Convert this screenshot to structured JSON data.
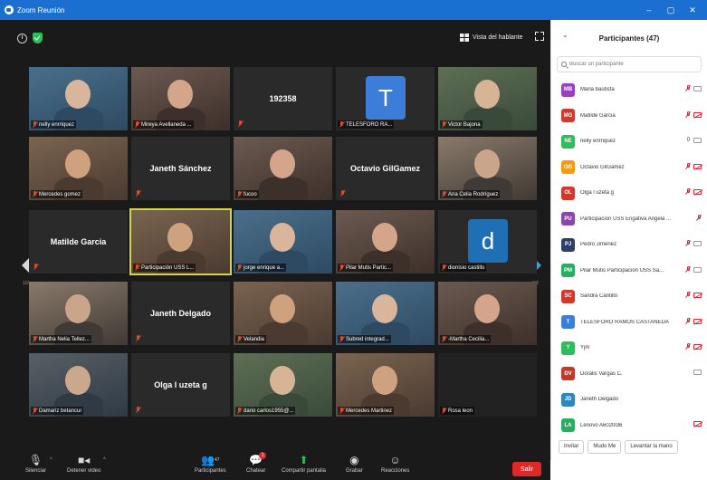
{
  "window": {
    "title": "Zoom Reunión"
  },
  "topbar": {
    "view_label": "Vista del hablante"
  },
  "colors": {
    "accent": "#1b6fd1",
    "muted": "#e24a2b",
    "leave": "#e02828",
    "active_border": "#d6d34c"
  },
  "tiles": [
    {
      "name": "nelly enrriquez",
      "type": "video"
    },
    {
      "name": "Mireya Avellaneda ...",
      "type": "video"
    },
    {
      "name": "192358",
      "type": "name"
    },
    {
      "name": "TELESFORO RA...",
      "type": "avatar",
      "letter": "T"
    },
    {
      "name": "Victor Bajona",
      "type": "video"
    },
    {
      "name": "Mercedes gomez",
      "type": "video"
    },
    {
      "name": "Janeth Sánchez",
      "type": "name"
    },
    {
      "name": "fucoo",
      "type": "video"
    },
    {
      "name": "Octavio GilGamez",
      "type": "name"
    },
    {
      "name": "Ana Celia Rodríguez",
      "type": "video"
    },
    {
      "name": "Matilde Garcia",
      "type": "name"
    },
    {
      "name": "Participación USS L...",
      "type": "video",
      "active": true
    },
    {
      "name": "jorge enrique a...",
      "type": "video"
    },
    {
      "name": "Pilar Mutis Partic...",
      "type": "video"
    },
    {
      "name": "dionisio castillo",
      "type": "avatar",
      "letter": "d"
    },
    {
      "name": "Martha Nelia Tellez...",
      "type": "video"
    },
    {
      "name": "Janeth Delgado",
      "type": "name"
    },
    {
      "name": "Velandia",
      "type": "video"
    },
    {
      "name": "Subred integrad...",
      "type": "video"
    },
    {
      "name": "-Martha Cecilia...",
      "type": "video"
    },
    {
      "name": "Damariz betancur",
      "type": "video"
    },
    {
      "name": "Olga l uzeta g",
      "type": "name"
    },
    {
      "name": "dario carlos1955@...",
      "type": "video"
    },
    {
      "name": "Mercedes Martinez",
      "type": "video"
    },
    {
      "name": "Rosa leon",
      "type": "dark"
    }
  ],
  "pagination": {
    "left": "1/2",
    "right": "1/2"
  },
  "toolbar": {
    "mute": "Silenciar",
    "video": "Detener video",
    "participants": "Participantes",
    "participants_count": "47",
    "chat": "Chatear",
    "chat_badge": "1",
    "share": "Compartir pantalla",
    "record": "Grabar",
    "reactions": "Reacciones",
    "leave": "Salir"
  },
  "panel": {
    "title": "Participantes (47)",
    "search_placeholder": "Buscar un participante",
    "participants": [
      {
        "initials": "MB",
        "name": "Maria bautista",
        "color": "#9b3fbf",
        "mic": "off",
        "cam": "on"
      },
      {
        "initials": "MG",
        "name": "Matilde Garcia",
        "color": "#d0392b",
        "mic": "off",
        "cam": "off"
      },
      {
        "initials": "NE",
        "name": "nelly enrriquez",
        "color": "#2ebd59",
        "mic": "on",
        "cam": "on"
      },
      {
        "initials": "OG",
        "name": "Octavio GilGamez",
        "color": "#f39c12",
        "mic": "off",
        "cam": "off"
      },
      {
        "initials": "OL",
        "name": "Olga l uzeta g",
        "color": "#d0392b",
        "mic": "off",
        "cam": "off"
      },
      {
        "initials": "PU",
        "name": "Participación USS Engativá Angela ...",
        "color": "#8e44ad",
        "mic": "off",
        "cam": "none"
      },
      {
        "initials": "PJ",
        "name": "Pedro Jimenez",
        "color": "#2c3e6b",
        "mic": "off",
        "cam": "on"
      },
      {
        "initials": "PM",
        "name": "Pilar Mutis Participación USS Sa...",
        "color": "#27ae60",
        "mic": "off",
        "cam": "on"
      },
      {
        "initials": "SC",
        "name": "Sandra Cantillo",
        "color": "#d0392b",
        "mic": "off",
        "cam": "off"
      },
      {
        "initials": "T",
        "name": "TELESFORO RAMOS CASTAÑEDA",
        "color": "#3b7dd8",
        "mic": "off",
        "cam": "off"
      },
      {
        "initials": "Y",
        "name": "Yjm",
        "color": "#2ebd59",
        "mic": "off",
        "cam": "off"
      },
      {
        "initials": "DV",
        "name": "Doralis Vargas C.",
        "color": "#c0392b",
        "mic": "none",
        "cam": "on"
      },
      {
        "initials": "JD",
        "name": "Janeth Delgado",
        "color": "#2e86c1",
        "mic": "none",
        "cam": "none"
      },
      {
        "initials": "LA",
        "name": "Lenovo A6020l36",
        "color": "#27ae60",
        "mic": "none",
        "cam": "off"
      }
    ],
    "footer": {
      "invite": "Invitar",
      "mute_all": "Mudo Me",
      "raise_hand": "Levantar la mano"
    }
  }
}
